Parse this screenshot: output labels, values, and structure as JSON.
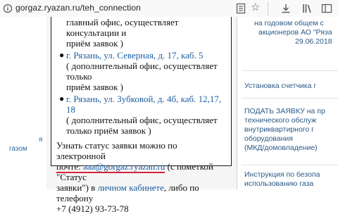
{
  "browser": {
    "url": "gorgaz.ryazan.ru/teh_connection"
  },
  "left": {
    "nav_lines": [
      "я",
      "газом"
    ]
  },
  "card": {
    "line1": "главный офис, осуществляет консультации и",
    "line2": "приём заявок )",
    "office2_link": "г. Рязань, ул. Северная, д. 17, каб. 5",
    "office2_desc_1": "( дополнительный офис, осуществляет только",
    "office2_desc_2": "приём заявок )",
    "office3_link": "г. Рязань, ул. Зубковой, д. 4б, каб. 12,17, 18",
    "office3_desc_1": "( дополнительный офис, осуществляет",
    "office3_desc_2": "только приём заявок )",
    "status_1": "Узнать статус заявки можно по электронной",
    "status_email_prefix": "почте:",
    "status_email": "aaa@gorgaz.ryazan.ru",
    "status_email_suffix": "(с пометкой \"Статус",
    "status_2_prefix": "заявки\") в",
    "status_cabinet": "личном кабинете",
    "status_2_suffix": ", либо по телефону",
    "phone": "+7 (4912) 93-73-78"
  },
  "right": {
    "notice_1": "на годовом общем с",
    "notice_2": "акционеров АО \"Ряза",
    "notice_date": "29.06.2018",
    "item_meter": "Установка счетчика г",
    "item_apply_1": "ПОДАТЬ ЗАЯВКУ на пр",
    "item_apply_2": "технического обслуж",
    "item_apply_3": "внутриквартирного г",
    "item_apply_4": "оборудования",
    "item_apply_5": "(МКД/домовладение)",
    "item_instr_1": "Инструкция по безопа",
    "item_instr_2": "использованию газа"
  },
  "colors": {
    "link": "#1a5e9e",
    "nav": "#2a6aa8",
    "annotation": "#d4243a",
    "rule": "#c8d3de"
  }
}
